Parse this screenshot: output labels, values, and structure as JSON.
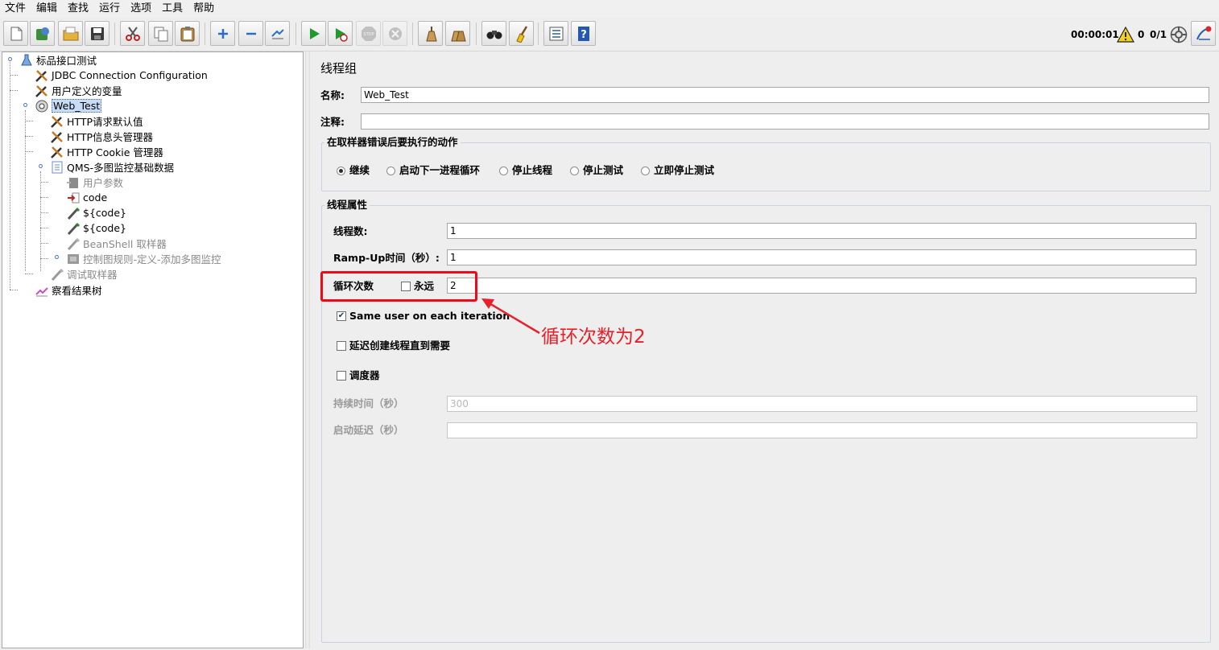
{
  "menu": [
    "文件",
    "编辑",
    "查找",
    "运行",
    "选项",
    "工具",
    "帮助"
  ],
  "toolbar": {
    "buttons": [
      "new-icon",
      "templates-icon",
      "open-icon",
      "save-icon",
      "cut-icon",
      "copy-icon",
      "paste-icon",
      "expand-icon",
      "collapse-icon",
      "toggle-icon",
      "start-icon",
      "start-no-timers-icon",
      "stop-icon",
      "shutdown-icon",
      "clear-icon",
      "clear-all-icon",
      "search-icon",
      "reset-search-icon",
      "function-helper-icon",
      "help-icon"
    ],
    "timer": "00:00:01",
    "warning_count": "0",
    "thread_count": "0/1"
  },
  "tree": [
    {
      "label": "标品接口测试",
      "icon": "test-plan-icon",
      "dim": false,
      "selected": false
    },
    {
      "label": "JDBC Connection Configuration",
      "icon": "config-element-icon",
      "dim": false,
      "selected": false
    },
    {
      "label": "用户定义的变量",
      "icon": "config-element-icon",
      "dim": false,
      "selected": false
    },
    {
      "label": "Web_Test",
      "icon": "thread-group-icon",
      "dim": false,
      "selected": true
    },
    {
      "label": "HTTP请求默认值",
      "icon": "config-element-icon",
      "dim": false,
      "selected": false
    },
    {
      "label": "HTTP信息头管理器",
      "icon": "config-element-icon",
      "dim": false,
      "selected": false
    },
    {
      "label": "HTTP Cookie 管理器",
      "icon": "config-element-icon",
      "dim": false,
      "selected": false
    },
    {
      "label": "QMS-多图监控基础数据",
      "icon": "transaction-controller-icon",
      "dim": false,
      "selected": false
    },
    {
      "label": "用户参数",
      "icon": "preprocessor-icon",
      "dim": true,
      "selected": false
    },
    {
      "label": "code",
      "icon": "extractor-icon",
      "dim": false,
      "selected": false
    },
    {
      "label": "${code}",
      "icon": "sampler-icon",
      "dim": false,
      "selected": false
    },
    {
      "label": "${code}",
      "icon": "sampler-icon",
      "dim": false,
      "selected": false
    },
    {
      "label": "BeanShell 取样器",
      "icon": "sampler-icon",
      "dim": true,
      "selected": false
    },
    {
      "label": "控制图规则-定义-添加多图监控",
      "icon": "controller-icon",
      "dim": true,
      "selected": false
    },
    {
      "label": "调试取样器",
      "icon": "sampler-icon",
      "dim": true,
      "selected": false
    },
    {
      "label": "察看结果树",
      "icon": "listener-icon",
      "dim": false,
      "selected": false
    }
  ],
  "panel": {
    "title": "线程组",
    "name_label": "名称:",
    "name_value": "Web_Test",
    "comment_label": "注释:",
    "comment_value": "",
    "error_group_title": "在取样器错误后要执行的动作",
    "error_actions": [
      {
        "label": "继续",
        "selected": true
      },
      {
        "label": "启动下一进程循环",
        "selected": false
      },
      {
        "label": "停止线程",
        "selected": false
      },
      {
        "label": "停止测试",
        "selected": false
      },
      {
        "label": "立即停止测试",
        "selected": false
      }
    ],
    "props_group_title": "线程属性",
    "threads_label": "线程数:",
    "threads_value": "1",
    "rampup_label": "Ramp-Up时间（秒）:",
    "rampup_value": "1",
    "loop_label": "循环次数",
    "forever_label": "永远",
    "forever_checked": false,
    "loop_value": "2",
    "same_user_label": "Same user on each iteration",
    "same_user_checked": true,
    "delay_create_label": "延迟创建线程直到需要",
    "delay_create_checked": false,
    "scheduler_label": "调度器",
    "scheduler_checked": false,
    "duration_label": "持续时间（秒）",
    "duration_value": "300",
    "startup_delay_label": "启动延迟（秒）",
    "startup_delay_value": ""
  },
  "annotation": {
    "text": "循环次数为2",
    "color": "#e8202a"
  }
}
